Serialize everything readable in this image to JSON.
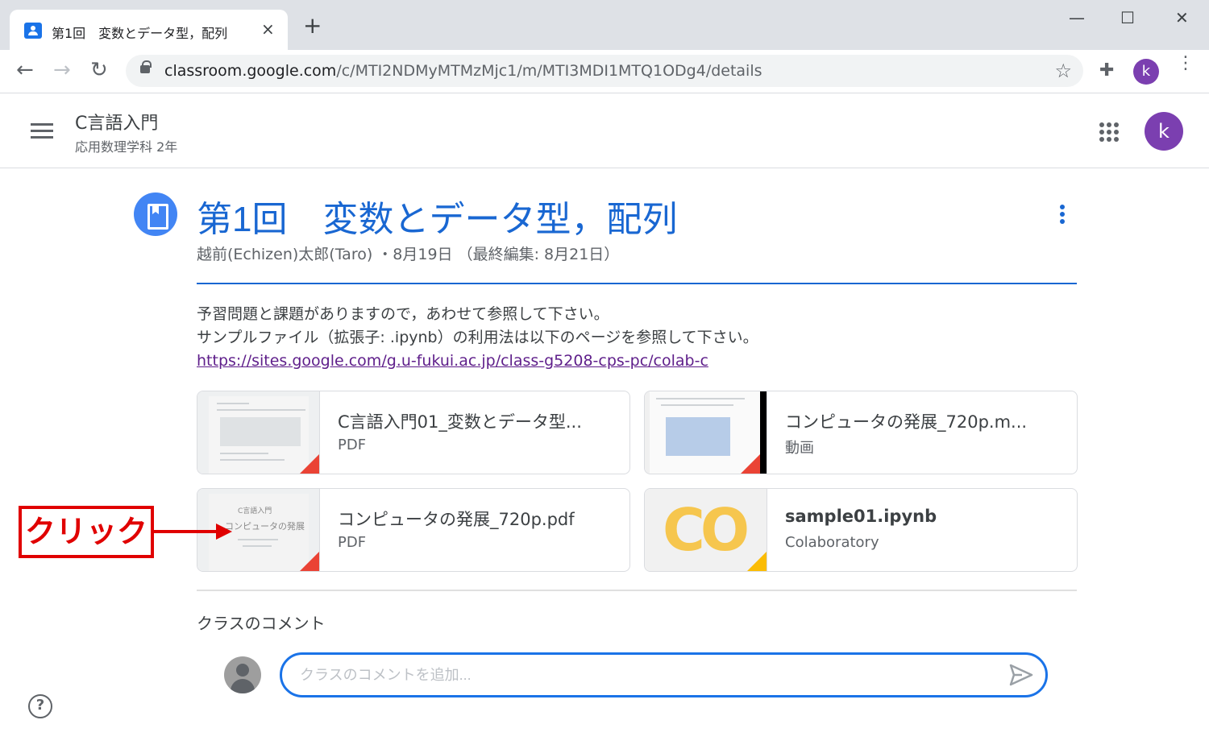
{
  "browser": {
    "tab_title": "第1回　変数とデータ型，配列",
    "tab_close": "×",
    "new_tab": "+",
    "window_minimize": "—",
    "window_maximize": "☐",
    "window_close": "✕",
    "url_host": "classroom.google.com",
    "url_path": "/c/MTI2NDMyMTMzMjc1/m/MTI3MDI1MTQ1ODg4/details",
    "profile_initial": "k"
  },
  "header": {
    "class_name": "C言語入門",
    "class_section": "応用数理学科 2年",
    "profile_initial": "k"
  },
  "post": {
    "title": "第1回　変数とデータ型，配列",
    "author": "越前(Echizen)太郎(Taro)",
    "date": "・8月19日 （最終編集: 8月21日）",
    "body_line1": "予習問題と課題がありますので，あわせて参照して下さい。",
    "body_line2": "サンプルファイル（拡張子: .ipynb）の利用法は以下のページを参照して下さい。",
    "link": "https://sites.google.com/g.u-fukui.ac.jp/class-g5208-cps-pc/colab-c"
  },
  "attachments": [
    {
      "title": "C言語入門01_変数とデータ型...",
      "type": "PDF",
      "fold_color": "#ea4335"
    },
    {
      "title": "コンピュータの発展_720p.m...",
      "type": "動画",
      "fold_color": "#ea4335"
    },
    {
      "title": "コンピュータの発展_720p.pdf",
      "type": "PDF",
      "fold_color": "#ea4335",
      "thumb_text1": "C言語入門",
      "thumb_text2": "コンピュータの発展"
    },
    {
      "title": "sample01.ipynb",
      "type": "Colaboratory",
      "fold_color": "#fbbc04",
      "thumb_logo": "CO"
    }
  ],
  "comments": {
    "label": "クラスのコメント",
    "placeholder": "クラスのコメントを追加..."
  },
  "help": "?",
  "annotation": {
    "label": "クリック",
    "color": "#e00000"
  },
  "colors": {
    "accent": "#1967d2",
    "profile": "#7b3fb0",
    "post_icon": "#4285f4"
  }
}
